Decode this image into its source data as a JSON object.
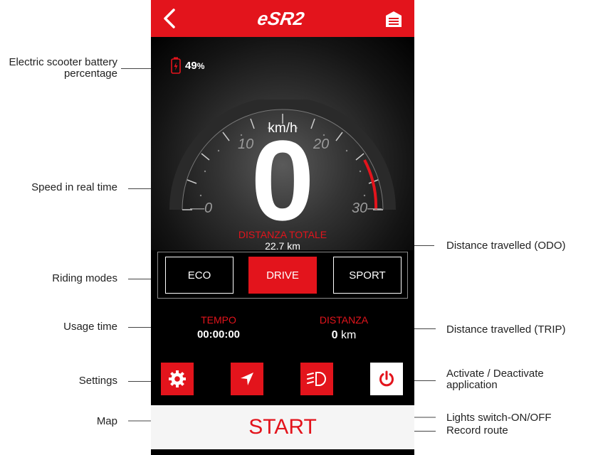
{
  "app": {
    "logo_text": "eSR2",
    "accent_color": "#e3141c"
  },
  "header": {
    "back_icon": "chevron-left-icon",
    "menu_icon": "list-menu-icon"
  },
  "battery": {
    "value": "49",
    "unit": "%"
  },
  "speedometer": {
    "unit": "km/h",
    "speed": "0",
    "tick_labels": [
      "0",
      "10",
      "20",
      "30"
    ]
  },
  "odometer": {
    "label": "DISTANZA TOTALE",
    "value": "22.7 km"
  },
  "riding_modes": [
    {
      "label": "ECO",
      "active": false
    },
    {
      "label": "DRIVE",
      "active": true
    },
    {
      "label": "SPORT",
      "active": false
    }
  ],
  "usage_time": {
    "label": "TEMPO",
    "value": "00:00:00"
  },
  "trip": {
    "label": "DISTANZA",
    "value": "0",
    "unit": "km"
  },
  "action_buttons": {
    "settings_icon": "gear-icon",
    "map_icon": "navigation-arrow-icon",
    "lights_icon": "headlight-icon",
    "power_icon": "power-icon"
  },
  "start_button": {
    "label": "START"
  },
  "callouts": {
    "battery": "Electric scooter battery percentage",
    "speed": "Speed in real time",
    "riding_modes": "Riding modes",
    "usage_time": "Usage time",
    "settings": "Settings",
    "map": "Map",
    "odo": "Distance travelled (ODO)",
    "trip": "Distance travelled (TRIP)",
    "power": "Activate / Deactivate application",
    "lights": "Lights switch-ON/OFF",
    "record": "Record route"
  }
}
